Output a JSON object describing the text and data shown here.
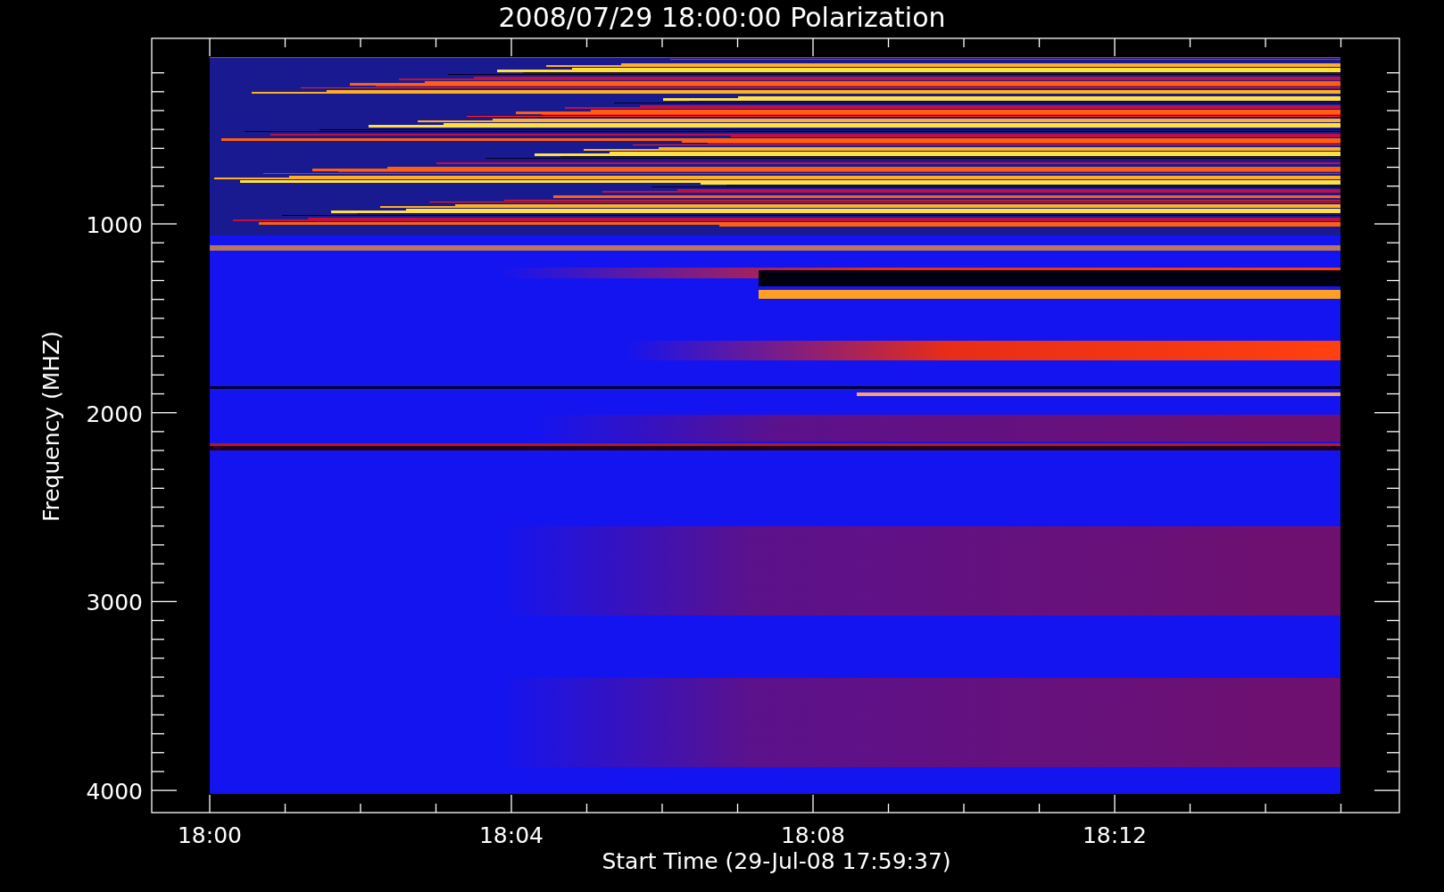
{
  "title": "2008/07/29 18:00:00 Polarization",
  "x_axis": {
    "label": "Start Time (29-Jul-08 17:59:37)",
    "ticks": [
      "18:00",
      "18:04",
      "18:08",
      "18:12"
    ]
  },
  "y_axis": {
    "label": "Frequency (MHZ)",
    "ticks": [
      "1000",
      "2000",
      "3000",
      "4000"
    ]
  }
}
